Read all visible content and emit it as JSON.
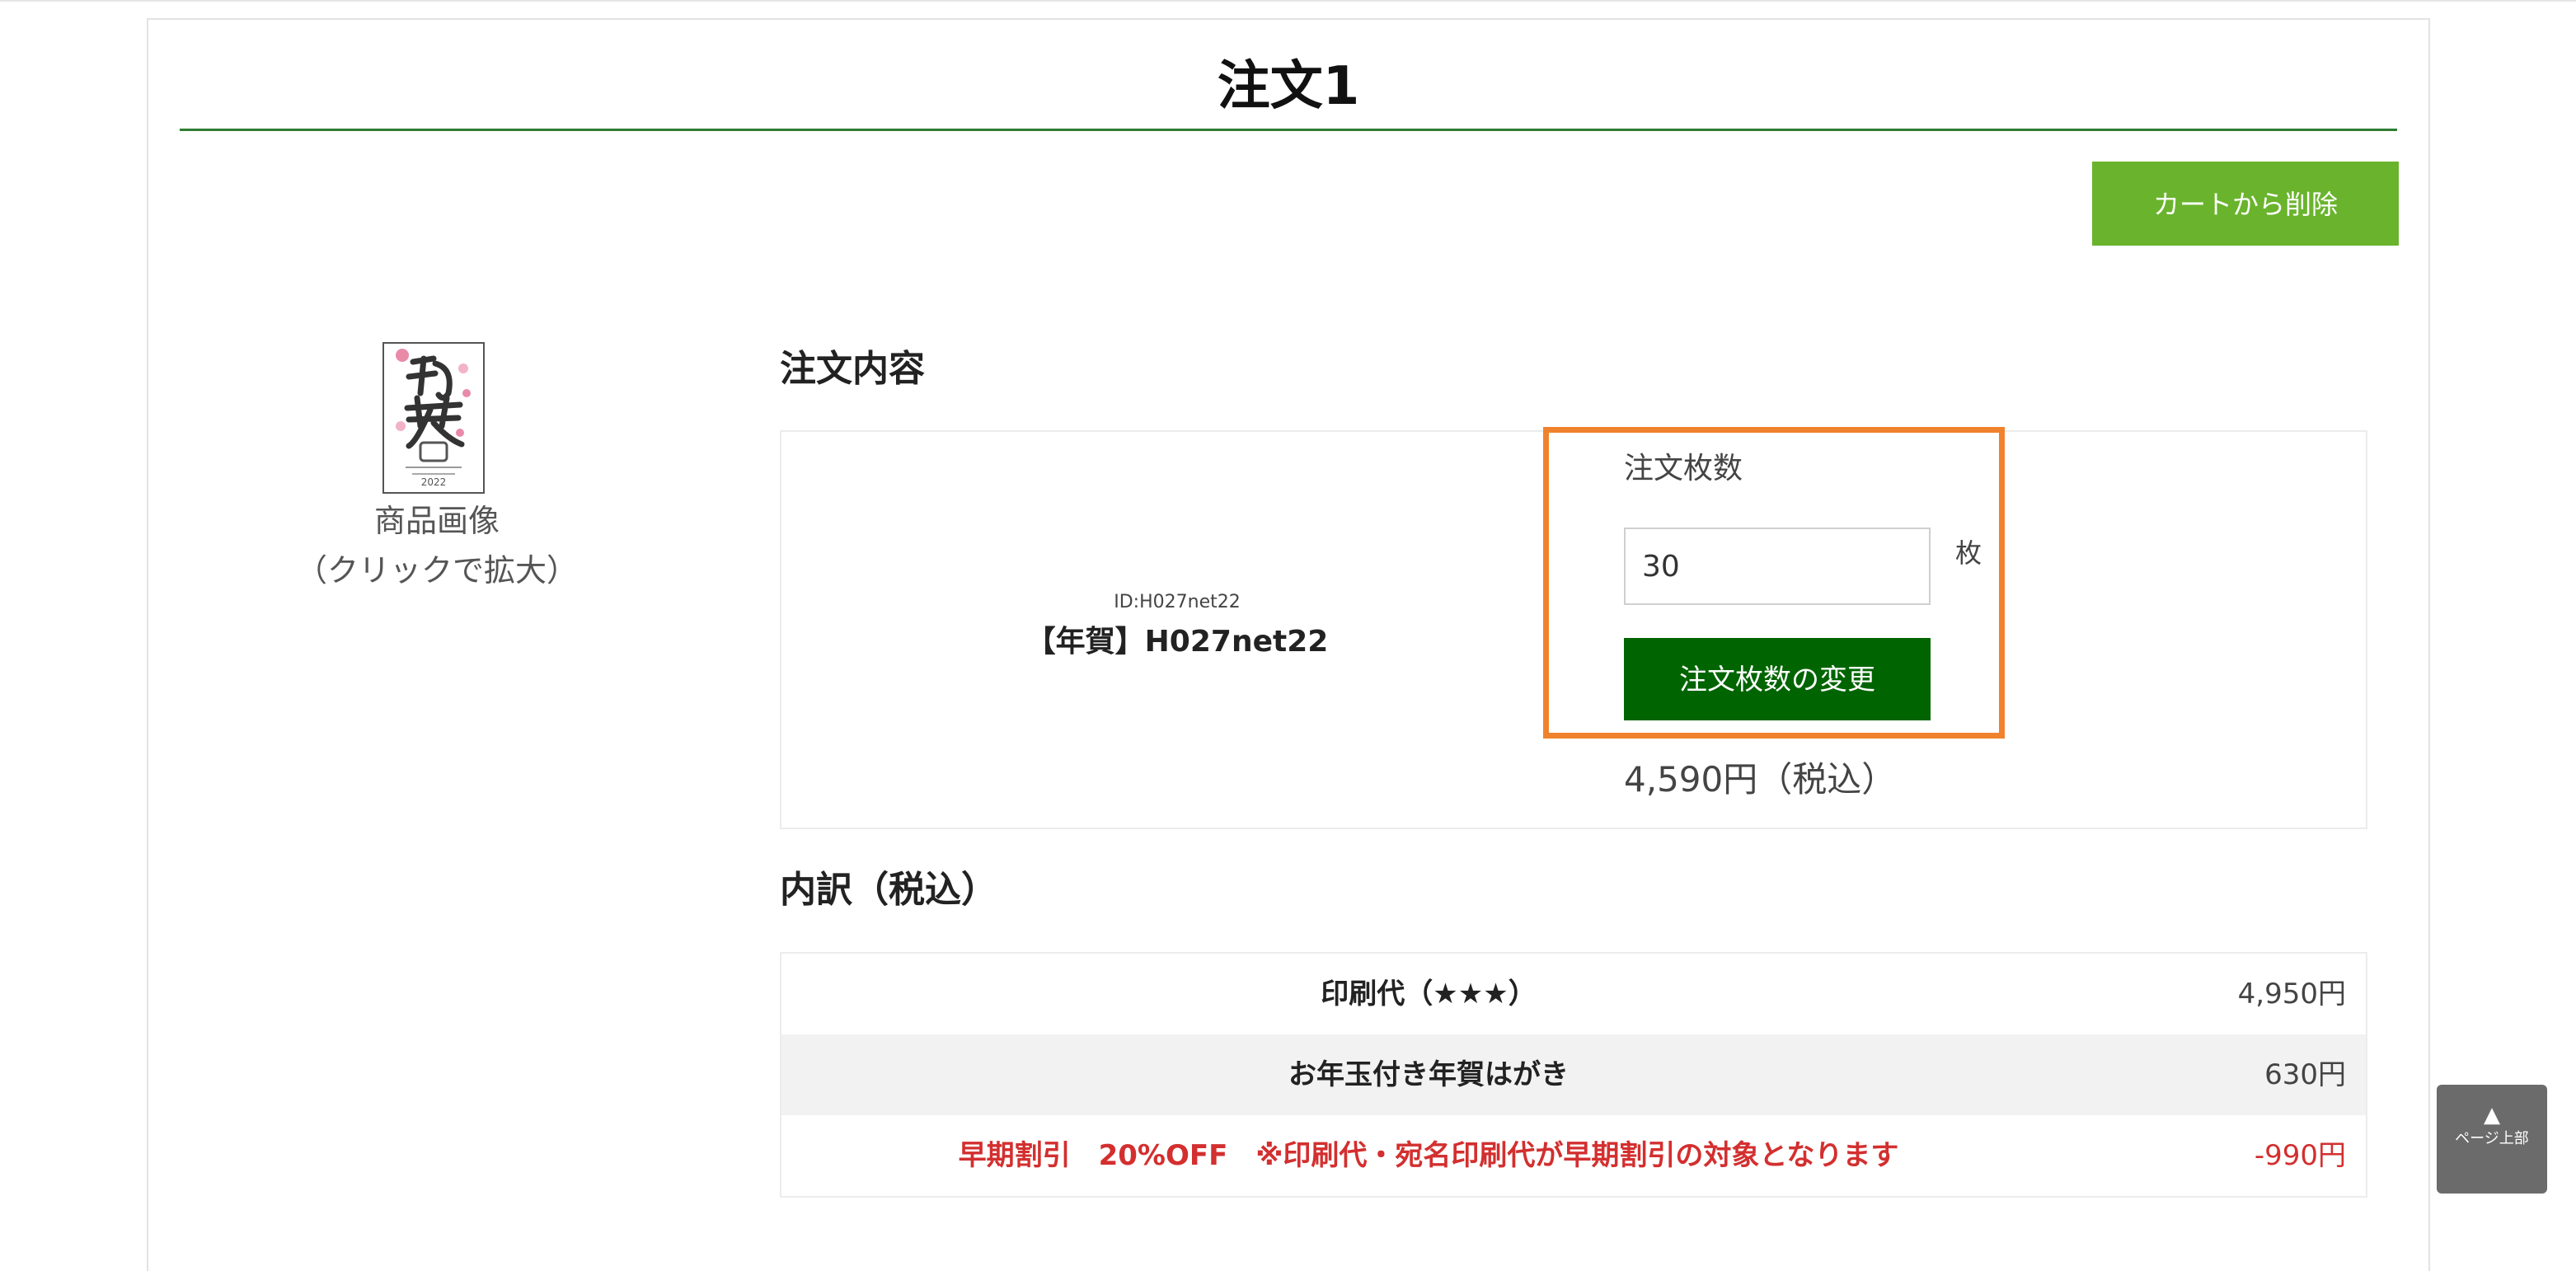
{
  "order": {
    "title": "注文1",
    "remove_button": "カートから削除",
    "image_caption_line1": "商品画像",
    "image_caption_line2": "（クリックで拡大）",
    "details_heading": "注文内容",
    "product_id": "ID:H027net22",
    "product_name": "【年賀】H027net22",
    "quantity_label": "注文枚数",
    "quantity_value": "30",
    "quantity_unit": "枚",
    "change_button": "注文枚数の変更",
    "price": "4,590円（税込）"
  },
  "breakdown": {
    "heading": "内訳（税込）",
    "rows": [
      {
        "label": "印刷代（★★★）",
        "value": "4,950円"
      },
      {
        "label": "お年玉付き年賀はがき",
        "value": "630円"
      },
      {
        "label": "早期割引　20%OFF　※印刷代・宛名印刷代が早期割引の対象となります",
        "value": "-990円"
      }
    ]
  },
  "page_top": {
    "arrow": "▲",
    "label": "ページ上部"
  },
  "colors": {
    "title_rule": "#2e7d32",
    "remove_button": "#6ab42d",
    "change_button": "#006400",
    "highlight": "#f0822d",
    "discount": "#d32f2f"
  }
}
